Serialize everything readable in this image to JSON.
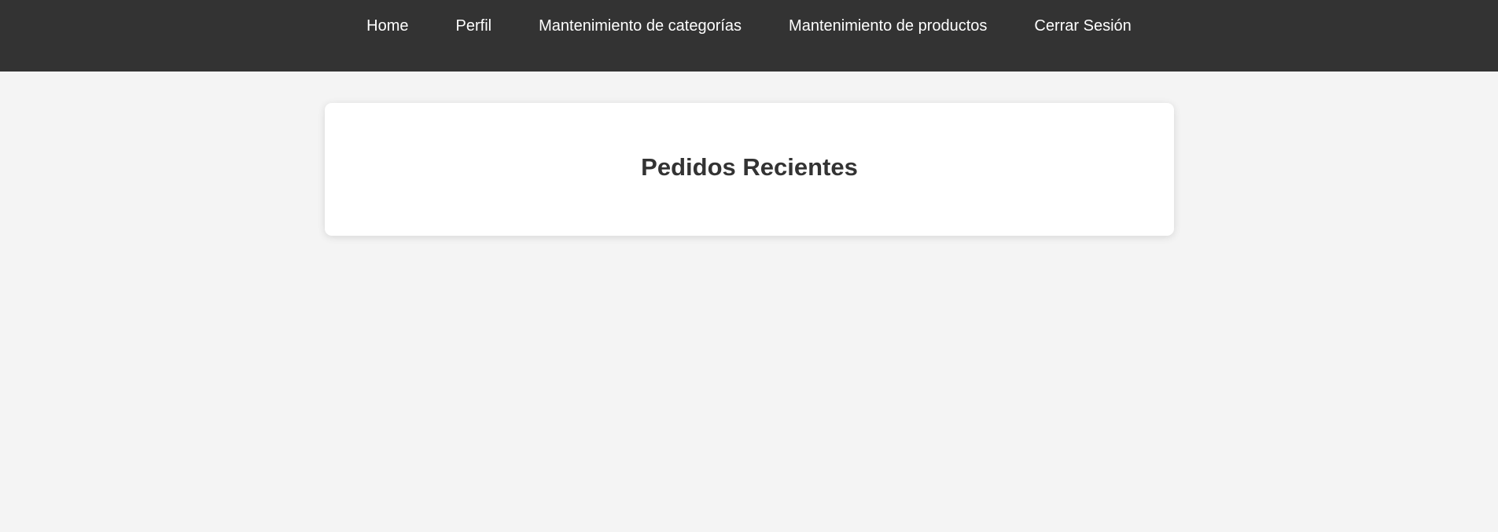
{
  "nav": {
    "items": [
      {
        "label": "Home"
      },
      {
        "label": "Perfil"
      },
      {
        "label": "Mantenimiento de categorías"
      },
      {
        "label": "Mantenimiento de productos"
      },
      {
        "label": "Cerrar Sesión"
      }
    ]
  },
  "main": {
    "title": "Pedidos Recientes"
  },
  "colors": {
    "nav_background": "#333333",
    "page_background": "#f4f4f4",
    "card_background": "#ffffff",
    "title_text": "#333333"
  }
}
